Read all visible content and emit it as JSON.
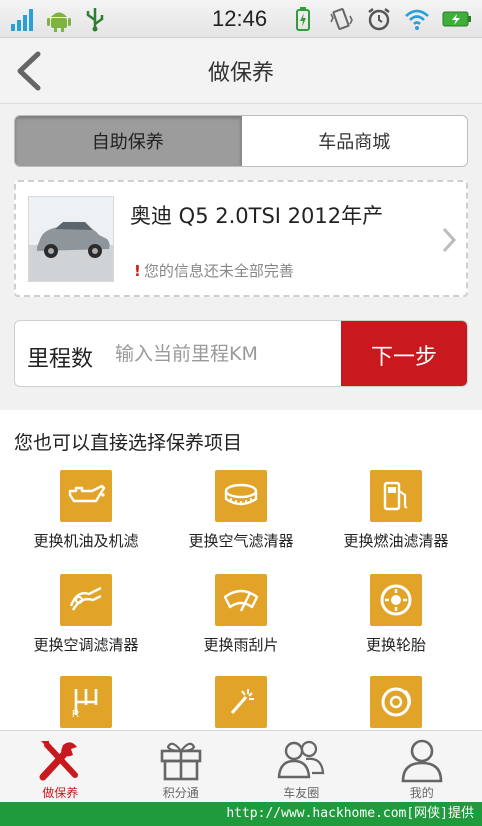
{
  "status_bar": {
    "time": "12:46",
    "icons_left": [
      "signal-icon",
      "android-icon",
      "usb-icon"
    ],
    "icons_right": [
      "battery-charging-icon",
      "vibrate-icon",
      "alarm-icon",
      "wifi-icon",
      "battery-icon"
    ]
  },
  "nav": {
    "title": "做保养"
  },
  "tabs": [
    {
      "label": "自助保养",
      "active": true
    },
    {
      "label": "车品商城",
      "active": false
    }
  ],
  "car": {
    "name": "奥迪 Q5 2.0TSI 2012年产",
    "warning_mark": "!",
    "warning": "您的信息还未全部完善"
  },
  "mileage": {
    "label": "里程数",
    "placeholder": "输入当前里程KM",
    "value": "",
    "next_label": "下一步"
  },
  "items": {
    "title": "您也可以直接选择保养项目",
    "list": [
      {
        "label": "更换机油及机滤",
        "icon": "oil-can-icon"
      },
      {
        "label": "更换空气滤清器",
        "icon": "air-filter-icon"
      },
      {
        "label": "更换燃油滤清器",
        "icon": "fuel-pump-icon"
      },
      {
        "label": "更换空调滤清器",
        "icon": "ac-filter-icon"
      },
      {
        "label": "更换雨刮片",
        "icon": "wiper-icon"
      },
      {
        "label": "更换轮胎",
        "icon": "tire-icon"
      },
      {
        "label": "",
        "icon": "gearbox-icon"
      },
      {
        "label": "",
        "icon": "spark-icon"
      },
      {
        "label": "",
        "icon": "brake-disc-icon"
      }
    ]
  },
  "tabbar": [
    {
      "label": "做保养",
      "icon": "wrench-screwdriver-icon",
      "active": true
    },
    {
      "label": "积分通",
      "icon": "gift-icon",
      "active": false
    },
    {
      "label": "车友圈",
      "icon": "friends-icon",
      "active": false
    },
    {
      "label": "我的",
      "icon": "user-icon",
      "active": false
    }
  ],
  "footer": {
    "text": "http://www.hackhome.com[网侠]提供"
  },
  "colors": {
    "accent_red": "#c7191e",
    "tile_yellow": "#e2a428",
    "footer_green": "#1f9b3e"
  }
}
